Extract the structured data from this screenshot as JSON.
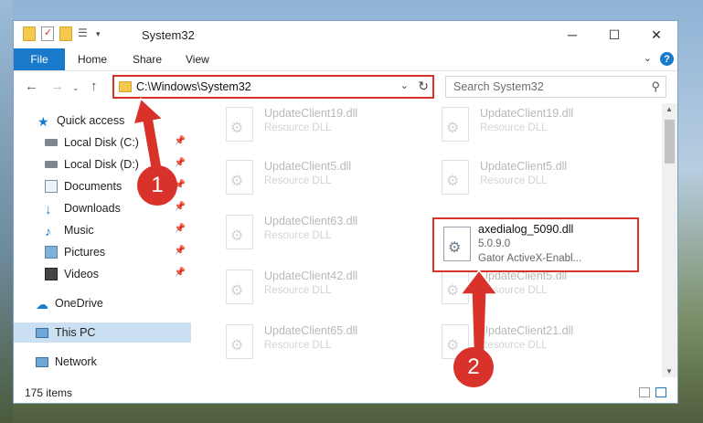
{
  "window": {
    "title": "System32",
    "minimize_glyph": "─",
    "maximize_glyph": "☐",
    "close_glyph": "✕"
  },
  "ribbon": {
    "file": "File",
    "tabs": [
      "Home",
      "Share",
      "View"
    ],
    "help": "?"
  },
  "address": {
    "path": "C:\\Windows\\System32"
  },
  "search": {
    "placeholder": "Search System32"
  },
  "nav": {
    "quick_access": "Quick access",
    "pinned": [
      {
        "label": "Local Disk (C:)",
        "icon": "drive-icon"
      },
      {
        "label": "Local Disk (D:)",
        "icon": "drive-icon"
      },
      {
        "label": "Documents",
        "icon": "documents-icon"
      },
      {
        "label": "Downloads",
        "icon": "downloads-icon"
      },
      {
        "label": "Music",
        "icon": "music-icon"
      },
      {
        "label": "Pictures",
        "icon": "pictures-icon"
      },
      {
        "label": "Videos",
        "icon": "videos-icon"
      }
    ],
    "onedrive": "OneDrive",
    "this_pc": "This PC",
    "network": "Network"
  },
  "files": [
    {
      "name": "UpdateClient19.dll",
      "type": "Resource DLL"
    },
    {
      "name": "UpdateClient19.dll",
      "type": "Resource DLL"
    },
    {
      "name": "UpdateClient5.dll",
      "type": "Resource DLL"
    },
    {
      "name": "UpdateClient5.dll",
      "type": "Resource DLL"
    },
    {
      "name": "UpdateClient63.dll",
      "type": "Resource DLL"
    },
    {
      "name": "UpdateClient42.dll",
      "type": "Resource DLL"
    },
    {
      "name": "UpdateClient5.dll",
      "type": "Resource DLL"
    },
    {
      "name": "UpdateClient65.dll",
      "type": "Resource DLL"
    },
    {
      "name": "UpdateClient21.dll",
      "type": "Resource DLL"
    }
  ],
  "highlighted_file": {
    "name": "axedialog_5090.dll",
    "version": "5.0.9.0",
    "description": "Gator ActiveX-Enabl..."
  },
  "status": {
    "items": "175 items"
  },
  "annotations": {
    "step1": "1",
    "step2": "2"
  },
  "colors": {
    "accent": "#1979ca",
    "annotation_red": "#d9322b"
  }
}
